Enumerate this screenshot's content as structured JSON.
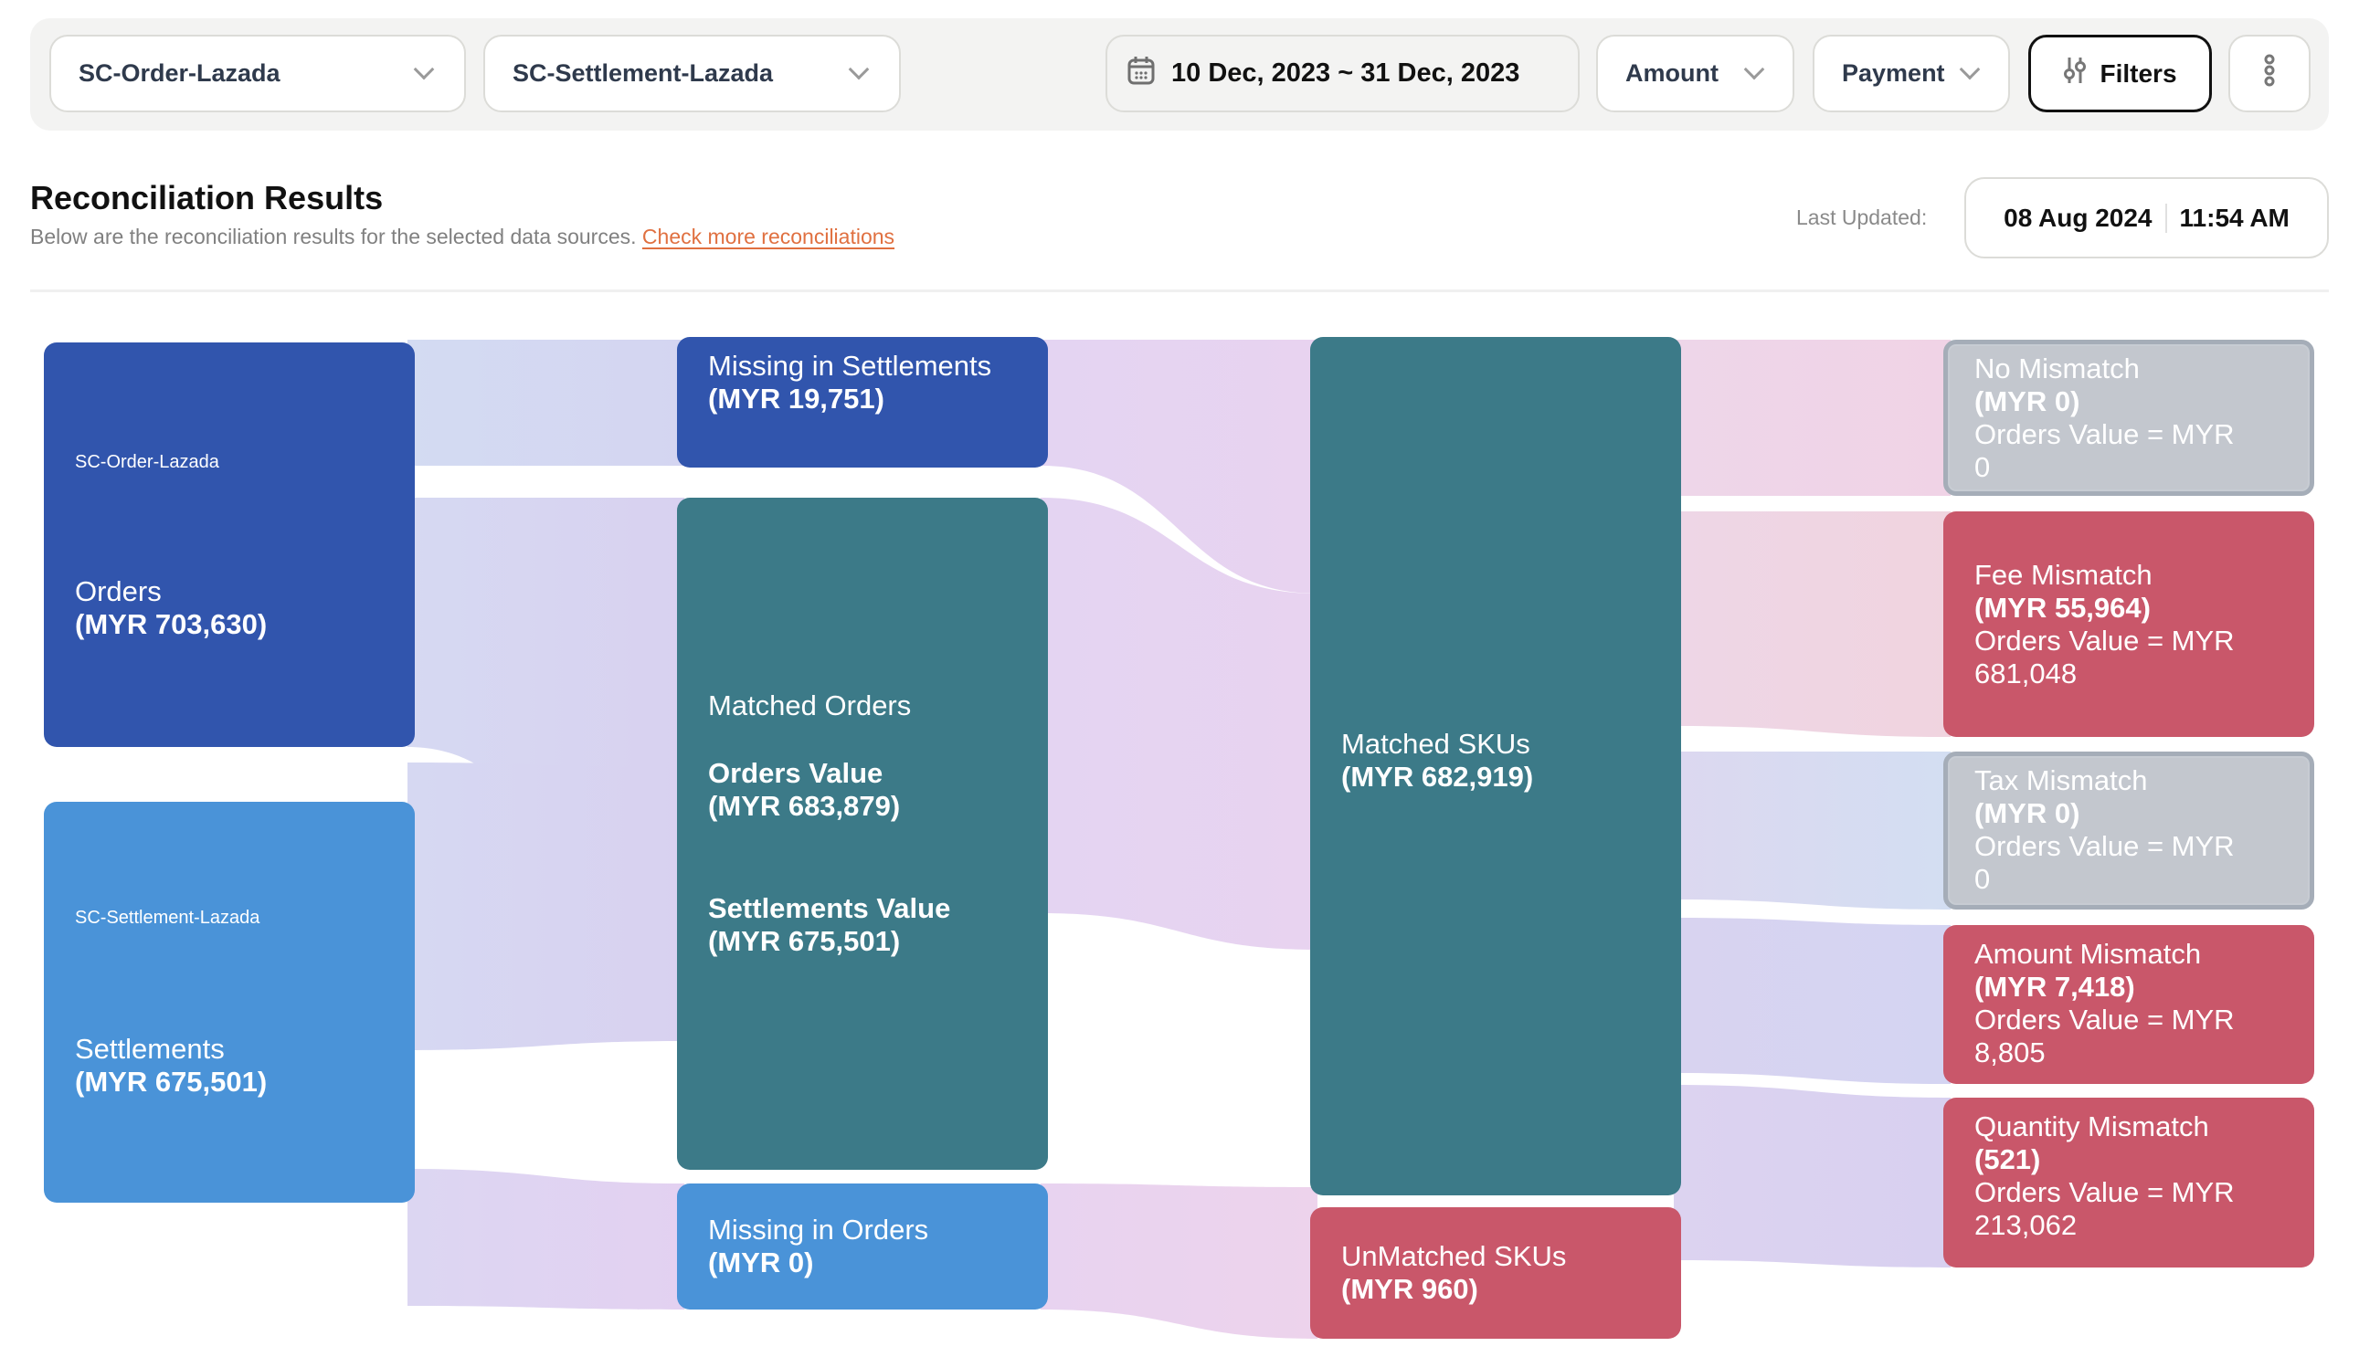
{
  "filters": {
    "source_1": "SC-Order-Lazada",
    "source_2": "SC-Settlement-Lazada",
    "date_range": "10 Dec, 2023 ~ 31 Dec, 2023",
    "amount": "Amount",
    "payment": "Payment",
    "filters_button": "Filters"
  },
  "header": {
    "title": "Reconciliation Results",
    "subtitle": "Below are the reconciliation results for the selected data sources.",
    "link": "Check more reconciliations",
    "last_updated_label": "Last Updated:",
    "last_updated_date": "08 Aug 2024",
    "last_updated_time": "11:54 AM"
  },
  "icons": {
    "date": "calendar-icon",
    "dropdown": "chevron-down-icon",
    "filters": "sliders-icon",
    "more": "kebab-menu-icon"
  },
  "colors": {
    "orders": "#3155ad",
    "settlements": "#4a93d8",
    "matched": "#3c7a88",
    "mismatch": "#c9576a",
    "empty": "#c3c7ce",
    "link": "#e07040"
  },
  "chart_data": {
    "type": "sankey",
    "currency": "MYR",
    "nodes": [
      {
        "id": "orders",
        "column": 0,
        "source_label": "SC-Order-Lazada",
        "label": "Orders",
        "value_text": "(MYR 703,630)",
        "value": 703630,
        "color": "orders"
      },
      {
        "id": "settlements",
        "column": 0,
        "source_label": "SC-Settlement-Lazada",
        "label": "Settlements",
        "value_text": "(MYR 675,501)",
        "value": 675501,
        "color": "settlements"
      },
      {
        "id": "missing_in_settlements",
        "column": 1,
        "label": "Missing in Settlements",
        "value_text": "(MYR 19,751)",
        "value": 19751,
        "color": "orders"
      },
      {
        "id": "matched_orders",
        "column": 1,
        "label": "Matched Orders",
        "sub": [
          {
            "label": "Orders Value",
            "value_text": "(MYR 683,879)",
            "value": 683879
          },
          {
            "label": "Settlements Value",
            "value_text": "(MYR 675,501)",
            "value": 675501
          }
        ],
        "color": "matched"
      },
      {
        "id": "missing_in_orders",
        "column": 1,
        "label": "Missing in Orders",
        "value_text": "(MYR 0)",
        "value": 0,
        "color": "settlements"
      },
      {
        "id": "matched_skus",
        "column": 2,
        "label": "Matched SKUs",
        "value_text": "(MYR 682,919)",
        "value": 682919,
        "color": "matched"
      },
      {
        "id": "unmatched_skus",
        "column": 2,
        "label": "UnMatched SKUs",
        "value_text": "(MYR 960)",
        "value": 960,
        "color": "mismatch"
      },
      {
        "id": "no_mismatch",
        "column": 3,
        "label": "No Mismatch",
        "value_text": "(MYR 0)",
        "value": 0,
        "orders_value_text": "Orders Value = MYR 0",
        "orders_value": 0,
        "color": "empty"
      },
      {
        "id": "fee_mismatch",
        "column": 3,
        "label": "Fee Mismatch",
        "value_text": "(MYR 55,964)",
        "value": 55964,
        "orders_value_text": "Orders Value = MYR 681,048",
        "orders_value": 681048,
        "color": "mismatch"
      },
      {
        "id": "tax_mismatch",
        "column": 3,
        "label": "Tax Mismatch",
        "value_text": "(MYR 0)",
        "value": 0,
        "orders_value_text": "Orders Value = MYR 0",
        "orders_value": 0,
        "color": "empty"
      },
      {
        "id": "amount_mismatch",
        "column": 3,
        "label": "Amount Mismatch",
        "value_text": "(MYR 7,418)",
        "value": 7418,
        "orders_value_text": "Orders Value = MYR 8,805",
        "orders_value": 8805,
        "color": "mismatch"
      },
      {
        "id": "quantity_mismatch",
        "column": 3,
        "label": "Quantity Mismatch",
        "value_text": "(521)",
        "value": 521,
        "orders_value_text": "Orders Value = MYR 213,062",
        "orders_value": 213062,
        "color": "mismatch"
      }
    ],
    "links": [
      {
        "source": "orders",
        "target": "missing_in_settlements"
      },
      {
        "source": "orders",
        "target": "matched_orders"
      },
      {
        "source": "settlements",
        "target": "matched_orders"
      },
      {
        "source": "settlements",
        "target": "missing_in_orders"
      },
      {
        "source": "missing_in_settlements",
        "target": "matched_skus"
      },
      {
        "source": "matched_orders",
        "target": "matched_skus"
      },
      {
        "source": "missing_in_orders",
        "target": "unmatched_skus"
      },
      {
        "source": "matched_skus",
        "target": "no_mismatch"
      },
      {
        "source": "matched_skus",
        "target": "fee_mismatch"
      },
      {
        "source": "matched_skus",
        "target": "tax_mismatch"
      },
      {
        "source": "matched_skus",
        "target": "amount_mismatch"
      },
      {
        "source": "matched_skus",
        "target": "quantity_mismatch"
      }
    ]
  }
}
